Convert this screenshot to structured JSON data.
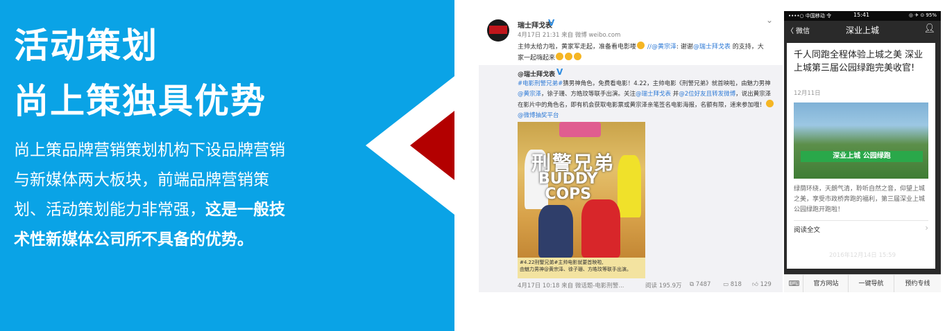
{
  "left": {
    "headline_line1": "活动策划",
    "headline_line2": "尚上策独具优势",
    "body_normal": "尚上策品牌营销策划机构下设品牌营销与新媒体两大板块，前端品牌营销策划、活动策划能力非常强，",
    "body_bold": "这是一般技术性新媒体公司所不具备的优势。",
    "colors": {
      "panel": "#0aa3e6",
      "accent_triangle": "#b30000"
    }
  },
  "weibo": {
    "account_name": "瑞士拜戈表",
    "verified_icon": "V",
    "meta": "4月17日 21:31 来自 微博 weibo.com",
    "chevron": "⌄",
    "post_text_part1": "主帅太给力啦，黄家军走起，准备看电影喽",
    "post_text_part2": " //",
    "post_mention1": "@黄宗泽",
    "post_text_part3": ": 谢谢",
    "post_mention2": "@瑞士拜戈表",
    "post_text_part4": " 的支持，大家一起嗨起来",
    "repost": {
      "account_name": "@瑞士拜戈表",
      "verified_icon": "V",
      "hashtag": "#电影刑警兄弟#",
      "text1": "猜男神角色，免费看电影！4.22，主帅电影《刑警兄弟》就首映啦，由魅力男神",
      "mention1": "@黄宗泽",
      "text2": "，徐子珊、方皓玟等联手出演。关注",
      "mention2": "@瑞士拜戈表",
      "text3": " 并",
      "mention3": "@2位好友且转发微博",
      "text4": "，说出黄宗泽在影片中的角色名，即有机会获取电影票或黄宗泽亲笔签名电影海报，名额有限，速来参加哦！",
      "lottery_link": "@微博抽奖平台",
      "poster": {
        "title_cn": "刑警兄弟",
        "title_en_1": "BUDDY",
        "title_en_2": "COPS",
        "caption_1": "#4.22刑警兄弟#主帅电影就要首映啦,",
        "caption_2": "由魅力男神@黄宗泽、徐子珊、方皓玟等联手出演。"
      },
      "footer_time": "4月17日 10:18 来自 微话题-电影刑警...",
      "reads": "阅读 195.9万",
      "reposts": "7487",
      "comments": "818",
      "likes": "129"
    }
  },
  "phone": {
    "carrier": "••••○ 中国移动 令",
    "clock": "15:41",
    "battery": "◎ ✈ ⊙ 95%",
    "back_label": "〈 微信",
    "title": "深业上城",
    "profile_icon": "person-icon",
    "article": {
      "title": "千人同跑全程体验上城之美 深业上城第三届公园绿跑完美收官!",
      "date": "12月11日",
      "banner": "深业上城   公园绿跑",
      "description": "绿荫环绕，天朗气清，聆听自然之音，仰望上城之美，享受市政桥奔跑的福利，第三届深业上城公园绿跑开跑啦！",
      "read_full": "阅读全文"
    },
    "timestamp": "2016年12月14日 15:59",
    "menu": [
      "官方网站",
      "一键导航",
      "预约专线"
    ]
  }
}
